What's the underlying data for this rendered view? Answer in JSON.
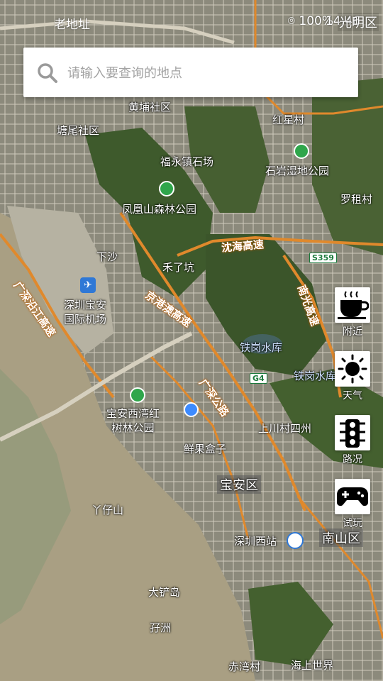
{
  "status_bar": {
    "left_text": "老地址",
    "battery": "100%",
    "time": "14:46",
    "district": "光明区"
  },
  "search": {
    "placeholder": "请输入要查询的地点"
  },
  "map_labels": {
    "huangpu": "黄埔社区",
    "tangwei": "塘尾社区",
    "hongxing": "红星村",
    "fuyong": "福永镇石场",
    "shiyan": "石岩湿地公园",
    "luozu": "罗租村",
    "fenghuang": "凤凰山森林公园",
    "xiasha": "下沙",
    "heliao": "禾了坑",
    "airport": "深圳宝安\n国际机场",
    "tiegang": "铁岗水库",
    "tiegang2": "铁岗水库",
    "baoan_park": "宝安西湾红\n树林公园",
    "shangchuan": "上川村四州",
    "xianguo": "鲜果盒子",
    "baoan": "宝安区",
    "yazai": "丫仔山",
    "xizhan": "深圳西站",
    "nanshan": "南山区",
    "dachan": "大铲岛",
    "xunzhou": "孖洲",
    "chiwan": "赤湾村",
    "haishang": "海上世界"
  },
  "road_labels": {
    "shenhai": "沈海高速",
    "jinggang": "京港澳高速",
    "guangshen_coast": "广深沿江高速",
    "nanguang": "南光高速",
    "guangshen_road": "广深公路",
    "s359": "S359",
    "g4": "G4"
  },
  "sidebar": {
    "nearby_label": "附近",
    "weather_label": "天气",
    "traffic_label": "路况",
    "game_label": "试玩"
  },
  "colors": {
    "expressway": "#e0892c",
    "sea": "#a89d7e",
    "green": "#3e5a2c"
  }
}
